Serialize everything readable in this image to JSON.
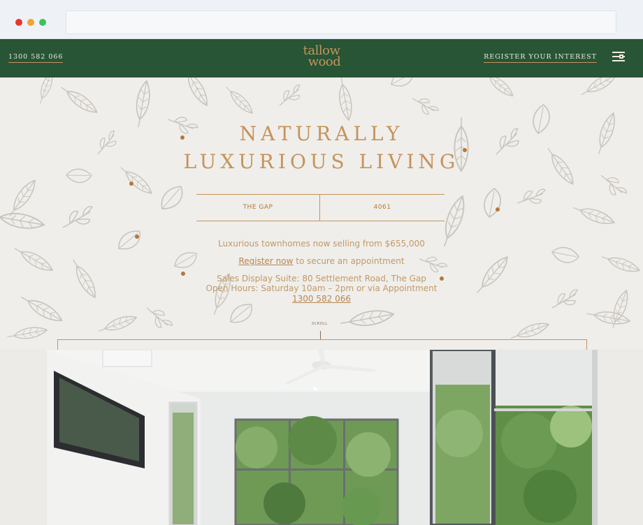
{
  "browser": {
    "controls": [
      "close",
      "minimize",
      "maximize"
    ]
  },
  "header": {
    "phone": "1300 582 066",
    "logo_line1": "tallow",
    "logo_line2": "wood",
    "register_label": "REGISTER YOUR INTEREST",
    "menu_icon": "menu-icon"
  },
  "hero": {
    "title_line1": "NATURALLY",
    "title_line2": "LUXURIOUS LIVING",
    "location_suburb": "THE GAP",
    "location_postcode": "4061",
    "price_text": "Luxurious townhomes now selling from $655,000",
    "register_link": "Register now",
    "register_suffix": " to secure an appointment",
    "sales_display": "Sales Display Suite: 80 Settlement Road, The Gap",
    "open_hours": "Open Hours: Saturday 10am – 2pm or via Appointment",
    "phone": "1300 582 066",
    "scroll_label": "SCROLL"
  },
  "colors": {
    "header_bg": "#275535",
    "accent_gold": "#c6935b",
    "hero_bg": "#efeeeb"
  }
}
